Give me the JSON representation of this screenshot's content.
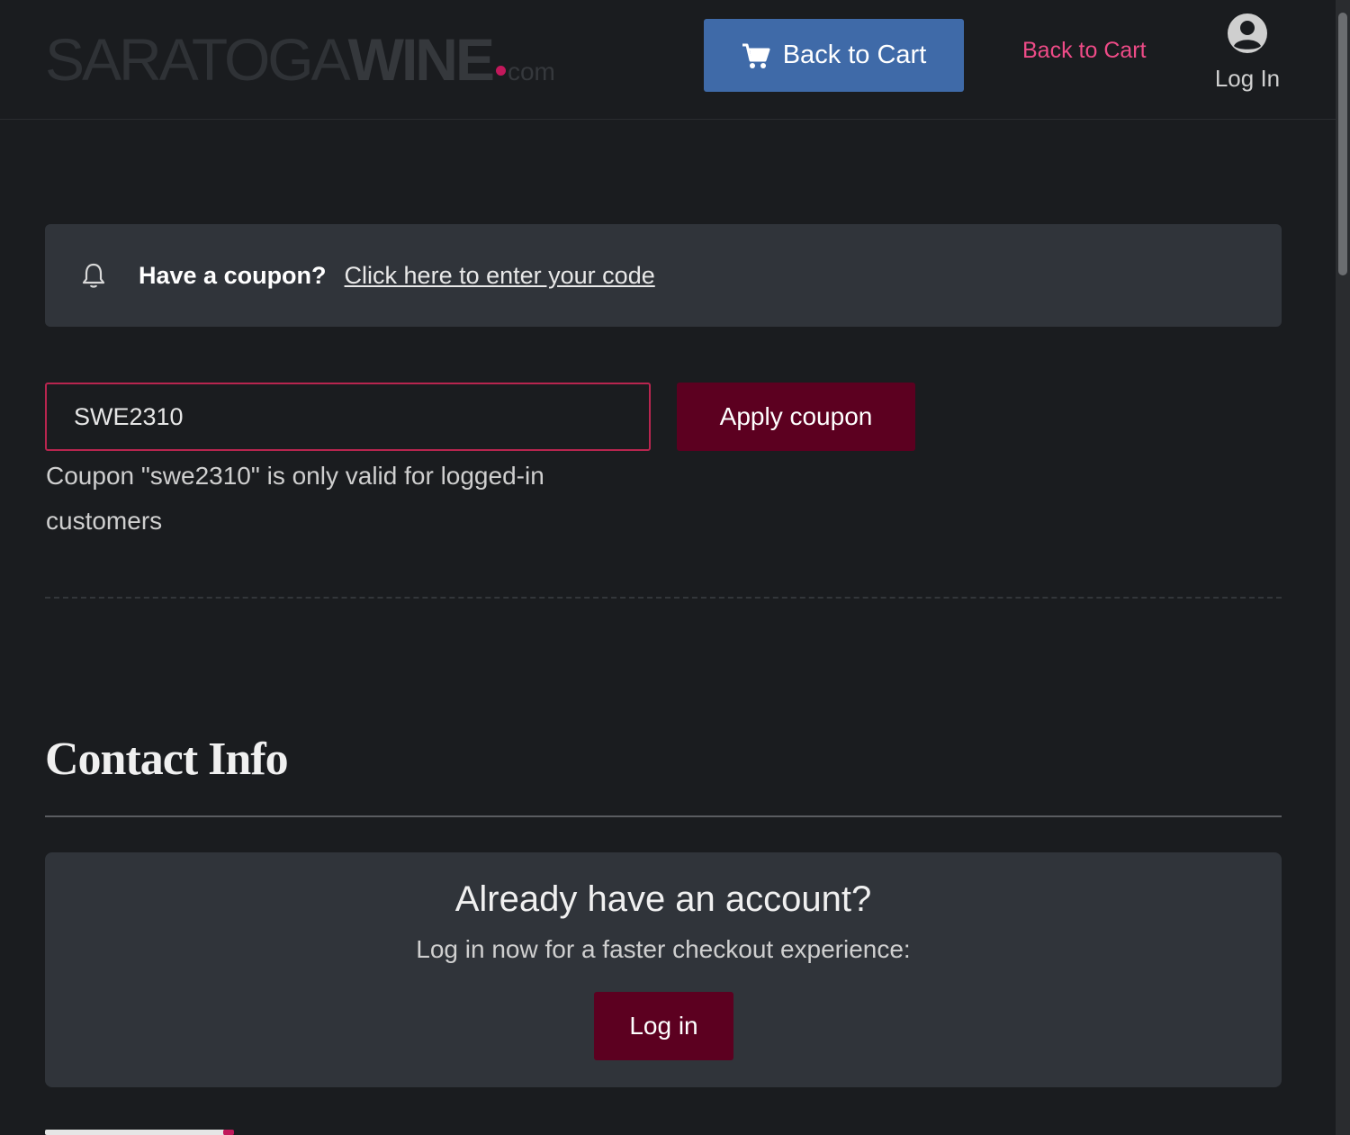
{
  "header": {
    "logo": {
      "part1": "SARATOGA",
      "part2": "WINE",
      "part3": "com"
    },
    "cart_button_label": "Back to Cart",
    "cart_link_label": "Back to Cart",
    "login_label": "Log In"
  },
  "coupon_notice": {
    "question": "Have a coupon?",
    "link": "Click here to enter your code"
  },
  "coupon_form": {
    "value": "SWE2310",
    "apply_label": "Apply coupon",
    "error": "Coupon \"swe2310\" is only valid for logged-in customers"
  },
  "contact": {
    "title": "Contact Info",
    "account_title": "Already have an account?",
    "account_subtitle": "Log in now for a faster checkout experience:",
    "login_button": "Log in"
  },
  "colors": {
    "background": "#1a1c1f",
    "panel": "#30343a",
    "primary_button": "#3f6aa8",
    "accent_link": "#ee4b87",
    "wine_button": "#5c0020",
    "error_border": "#b8254f"
  },
  "icons": {
    "cart": "cart-icon",
    "user": "user-circle-icon",
    "bell": "bell-icon"
  }
}
